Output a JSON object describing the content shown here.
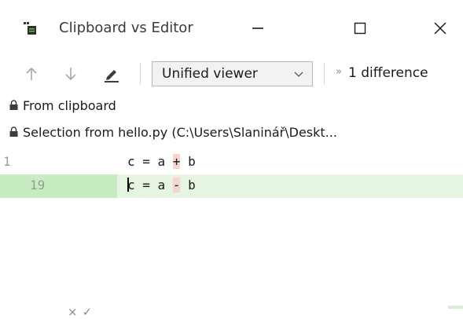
{
  "window": {
    "title": "Clipboard vs Editor",
    "icon": "compare-files-icon",
    "controls": [
      "minimize-icon",
      "maximize-icon",
      "close-icon"
    ]
  },
  "toolbar": {
    "prev_icon": "arrow-up-icon",
    "next_icon": "arrow-down-icon",
    "edit_icon": "pencil-icon",
    "viewer_select": {
      "value": "Unified viewer"
    },
    "more_icon": "double-chevron-right-icon",
    "differences_label": "1 difference"
  },
  "panels": {
    "left_label": "From clipboard",
    "right_label": "Selection from hello.py (C:\\Users\\Slaninář\\Deskt..."
  },
  "diff": {
    "lines": [
      {
        "line_number": "1",
        "marker_x": "×",
        "marker_check": "✓",
        "code_parts": [
          "c = a ",
          "+",
          " b"
        ]
      },
      {
        "line_number": "19",
        "code_parts": [
          "c = a ",
          "-",
          " b"
        ]
      }
    ]
  },
  "colors": {
    "added_gutter": "#c8ecc2",
    "added_line": "#e5f5e2",
    "inline_change": "#f6d5d1"
  }
}
